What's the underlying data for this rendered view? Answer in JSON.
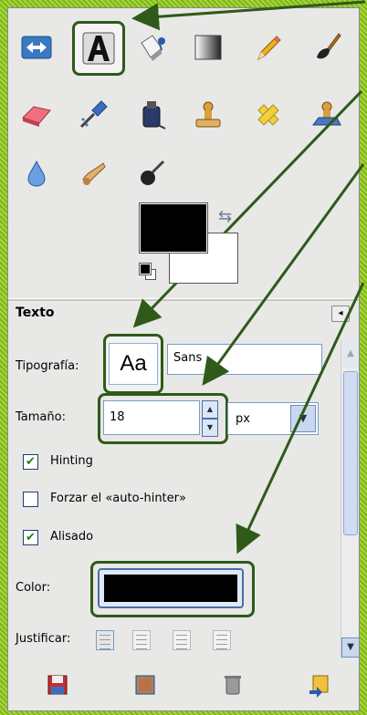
{
  "toolbox": {
    "tools": [
      {
        "name": "align-tool-icon"
      },
      {
        "name": "text-tool-icon",
        "selected": true
      },
      {
        "name": "bucket-fill-icon"
      },
      {
        "name": "blend-icon"
      },
      {
        "name": "pencil-icon"
      },
      {
        "name": "paintbrush-icon"
      },
      {
        "name": "eraser-icon"
      },
      {
        "name": "airbrush-icon"
      },
      {
        "name": "ink-icon"
      },
      {
        "name": "clone-icon"
      },
      {
        "name": "heal-icon"
      },
      {
        "name": "perspective-clone-icon"
      },
      {
        "name": "blur-sharpen-icon"
      },
      {
        "name": "smudge-icon"
      },
      {
        "name": "dodge-burn-icon"
      }
    ],
    "foreground_color": "#000000",
    "background_color": "#ffffff"
  },
  "options": {
    "title": "Texto",
    "font_label": "Tipografía:",
    "font_preview": "Aa",
    "font_value": "Sans",
    "size_label": "Tamaño:",
    "size_value": "18",
    "unit_value": "px",
    "hinting_label": "Hinting",
    "hinting_checked": true,
    "autohinter_label": "Forzar el «auto-hinter»",
    "autohinter_checked": false,
    "antialias_label": "Alisado",
    "antialias_checked": true,
    "color_label": "Color:",
    "color_value": "#000000",
    "justify_label": "Justificar:"
  },
  "bottom_bar": [
    "save-options-icon",
    "restore-options-icon",
    "delete-options-icon",
    "reset-options-icon"
  ],
  "colors": {
    "annotation": "#2f5a1a",
    "border_outer": "#8fc43a"
  }
}
